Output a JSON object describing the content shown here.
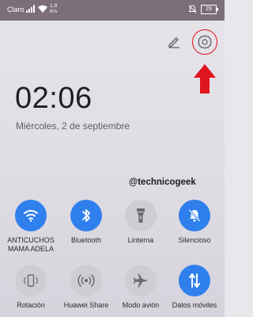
{
  "status_bar": {
    "carrier": "Claro",
    "network_speed_value": "1,9",
    "network_speed_unit": "K/s",
    "battery": "29",
    "icons": [
      "signal-icon",
      "wifi-icon",
      "mute-icon",
      "battery-icon"
    ]
  },
  "header": {
    "edit_icon": "pencil-icon",
    "settings_icon": "gear-icon",
    "highlight_color": "#e0141c"
  },
  "clock": {
    "time": "02:06",
    "date": "Miércoles, 2 de septiembre"
  },
  "watermark": "@technicogeek",
  "accent_color": "#2f80ed",
  "tiles": [
    {
      "label_line1": "ANTICUCHOS",
      "label_line2": "MAMA ADELA",
      "icon": "wifi-icon",
      "active": true
    },
    {
      "label_line1": "Bluetooth",
      "label_line2": "",
      "icon": "bluetooth-icon",
      "active": true
    },
    {
      "label_line1": "Linterna",
      "label_line2": "",
      "icon": "flashlight-icon",
      "active": false
    },
    {
      "label_line1": "Silencioso",
      "label_line2": "",
      "icon": "bell-mute-icon",
      "active": true
    },
    {
      "label_line1": "Rotación",
      "label_line2": "",
      "icon": "rotation-icon",
      "active": false
    },
    {
      "label_line1": "Huawei Share",
      "label_line2": "",
      "icon": "share-wireless-icon",
      "active": false
    },
    {
      "label_line1": "Modo avión",
      "label_line2": "",
      "icon": "airplane-icon",
      "active": false
    },
    {
      "label_line1": "Datos móviles",
      "label_line2": "",
      "icon": "mobile-data-icon",
      "active": true
    }
  ]
}
